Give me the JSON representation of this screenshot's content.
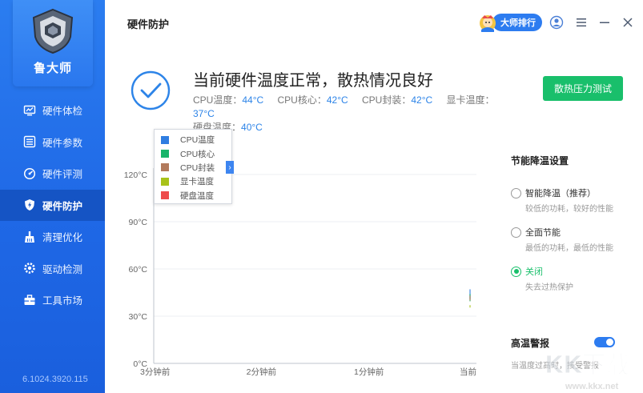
{
  "sidebar": {
    "brand": "鲁大师",
    "items": [
      {
        "label": "硬件体检",
        "icon": "monitor-icon"
      },
      {
        "label": "硬件参数",
        "icon": "list-icon"
      },
      {
        "label": "硬件评测",
        "icon": "gauge-icon"
      },
      {
        "label": "硬件防护",
        "icon": "shield-bolt-icon",
        "active": true
      },
      {
        "label": "清理优化",
        "icon": "broom-icon"
      },
      {
        "label": "驱动检测",
        "icon": "gear-icon"
      },
      {
        "label": "工具市场",
        "icon": "toolbox-icon"
      }
    ],
    "version": "6.1024.3920.115"
  },
  "header": {
    "title": "硬件防护",
    "rank_label": "大师排行"
  },
  "status": {
    "headline": "当前硬件温度正常，散热情况良好",
    "cpu_temp_label": "CPU温度：",
    "cpu_temp": "44°C",
    "cpu_core_label": "CPU核心：",
    "cpu_core": "42°C",
    "cpu_pkg_label": "CPU封装：",
    "cpu_pkg": "42°C",
    "gpu_label": "显卡温度：",
    "gpu": "37°C",
    "disk_label": "硬盘温度：",
    "disk": "40°C",
    "stress_button": "散热压力测试"
  },
  "chart_data": {
    "type": "line",
    "x": [
      "3分钟前",
      "2分钟前",
      "1分钟前",
      "当前"
    ],
    "y_ticks": [
      "0°C",
      "30°C",
      "60°C",
      "90°C",
      "120°C"
    ],
    "ylim": [
      0,
      120
    ],
    "series": [
      {
        "name": "CPU温度",
        "color": "#2f7de1",
        "values": [
          44
        ]
      },
      {
        "name": "CPU核心",
        "color": "#19b46a",
        "values": [
          42
        ]
      },
      {
        "name": "CPU封装",
        "color": "#b27a5c",
        "values": [
          42
        ]
      },
      {
        "name": "显卡温度",
        "color": "#a8c21a",
        "values": [
          37
        ]
      },
      {
        "name": "硬盘温度",
        "color": "#ee4b4b",
        "values": [
          40
        ]
      }
    ],
    "legend_placement": "top-left",
    "grid": true
  },
  "settings": {
    "title": "节能降温设置",
    "options": [
      {
        "label": "智能降温（推荐）",
        "desc": "较低的功耗，较好的性能",
        "selected": false
      },
      {
        "label": "全面节能",
        "desc": "最低的功耗，最低的性能",
        "selected": false
      },
      {
        "label": "关闭",
        "desc": "失去过热保护",
        "selected": true
      }
    ],
    "alert_title": "高温警报",
    "alert_desc": "当温度过高时，接受警报",
    "alert_on": true
  },
  "watermark": {
    "brand": "KK下载",
    "url": "www.kkx.net"
  }
}
